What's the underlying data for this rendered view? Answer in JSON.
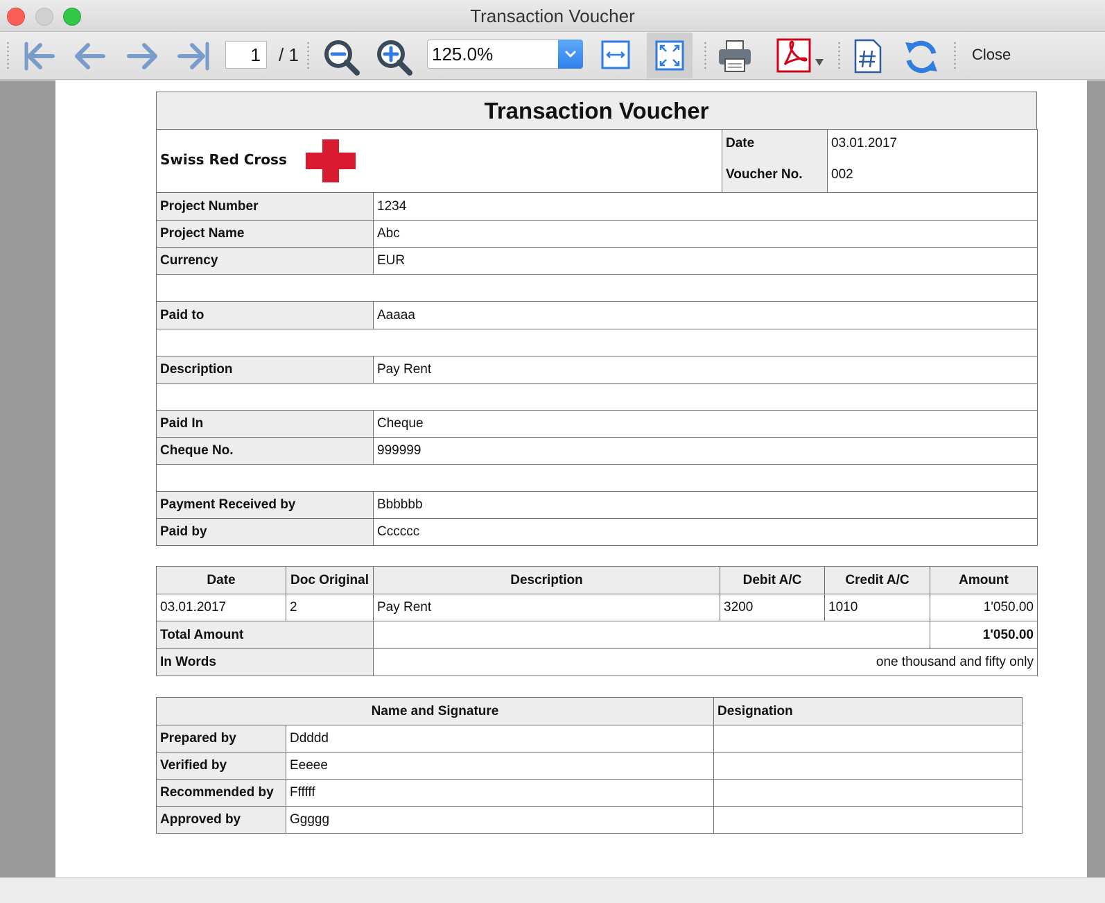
{
  "window": {
    "title": "Transaction Voucher"
  },
  "toolbar": {
    "page_current": "1",
    "page_total": "/ 1",
    "zoom": "125.0%",
    "close_label": "Close"
  },
  "voucher": {
    "title": "Transaction Voucher",
    "organization": "Swiss Red Cross",
    "date_label": "Date",
    "date_value": "03.01.2017",
    "voucher_no_label": "Voucher No.",
    "voucher_no_value": "002",
    "fields": {
      "project_number_label": "Project Number",
      "project_number": "1234",
      "project_name_label": "Project Name",
      "project_name": "Abc",
      "currency_label": "Currency",
      "currency": "EUR",
      "paid_to_label": "Paid to",
      "paid_to": "Aaaaa",
      "description_label": "Description",
      "description": "Pay Rent",
      "paid_in_label": "Paid In",
      "paid_in": "Cheque",
      "cheque_no_label": "Cheque No.",
      "cheque_no": "999999",
      "payment_received_by_label": "Payment Received by",
      "payment_received_by": "Bbbbbb",
      "paid_by_label": "Paid by",
      "paid_by": "Cccccc"
    },
    "entries": {
      "headers": [
        "Date",
        "Doc Original",
        "Description",
        "Debit A/C",
        "Credit A/C",
        "Amount"
      ],
      "row": [
        "03.01.2017",
        "2",
        "Pay Rent",
        "3200",
        "1010",
        "1'050.00"
      ],
      "total_label": "Total Amount",
      "total_value": "1'050.00",
      "in_words_label": "In Words",
      "in_words_value": "one thousand and fifty only"
    },
    "signatures": {
      "header_name": "Name and Signature",
      "header_designation": "Designation",
      "rows": [
        {
          "label": "Prepared by",
          "name": "Ddddd"
        },
        {
          "label": "Verified by",
          "name": "Eeeee"
        },
        {
          "label": "Recommended by",
          "name": "Ffffff"
        },
        {
          "label": "Approved by",
          "name": "Ggggg"
        }
      ]
    }
  }
}
